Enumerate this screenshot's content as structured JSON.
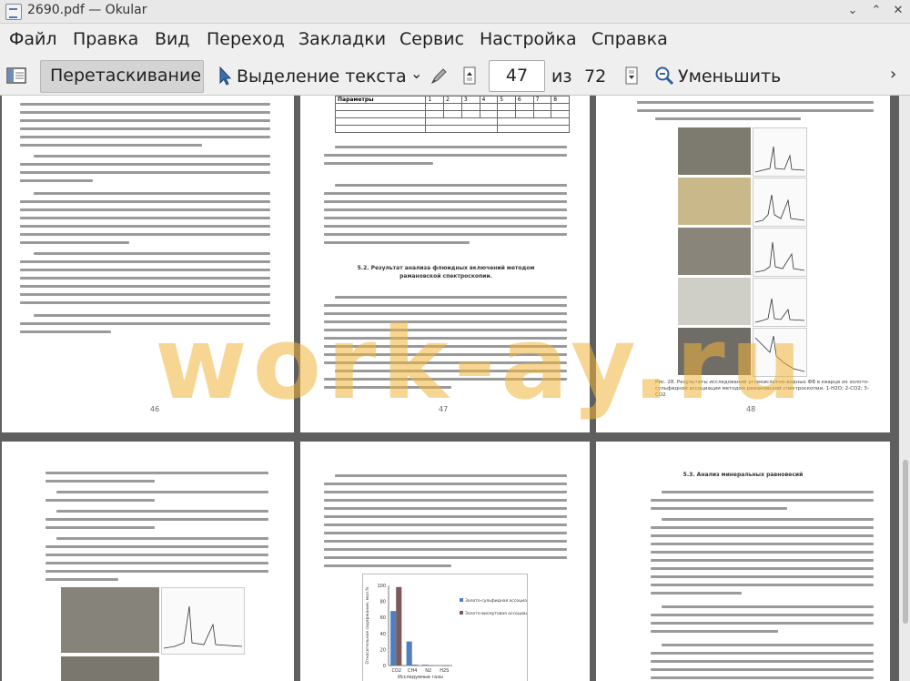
{
  "window": {
    "title": "2690.pdf  — Okular",
    "controls": [
      "minimize-icon",
      "maximize-icon",
      "close-icon"
    ]
  },
  "menu": [
    "Файл",
    "Правка",
    "Вид",
    "Переход",
    "Закладки",
    "Сервис",
    "Настройка",
    "Справка"
  ],
  "toolbar": {
    "browse_label": "Перетаскивание",
    "select_text_label": "Выделение текста",
    "page_current": "47",
    "page_of_label": "из",
    "page_total": "72",
    "zoom_out_label": "Уменьшить"
  },
  "pages": {
    "p46": "46",
    "p47": "47",
    "p48": "48",
    "p47_section": "5.2. Результат анализа флюидных включений методом рамановской спектроскопии.",
    "p50_section": "5.3. Анализ минеральных равновесий",
    "p48_caption": "Рис. 28. Результаты исследований углекислотно-водных ФВ в кварце из золото-сульфидной ассоциации методом рамановской спектроскопии. 1-H2O; 2-CO2; 3-CO2",
    "table_header": [
      "Параметры",
      "1",
      "2",
      "3",
      "4",
      "5",
      "6",
      "7",
      "8"
    ],
    "chart_legend": [
      "Золото-сульфидная ассоциация",
      "Золото-висмутовая ассоциация"
    ],
    "chart_xlabel": "Исследуемые газы",
    "chart_ylabel": "Относительное содержание, мол.%",
    "chart_x": [
      "CO2",
      "CH4",
      "N2",
      "H2S"
    ],
    "chart_y_ticks": [
      "100",
      "80",
      "60",
      "40",
      "20",
      "0"
    ]
  },
  "watermark": "work-ay.ru",
  "chart_data": {
    "type": "bar",
    "categories": [
      "CO2",
      "CH4",
      "N2",
      "H2S"
    ],
    "series": [
      {
        "name": "Золото-сульфидная ассоциация",
        "values": [
          68,
          30,
          1,
          0
        ],
        "color": "#4f7fc0"
      },
      {
        "name": "Золото-висмутовая ассоциация",
        "values": [
          98,
          1,
          0,
          0
        ],
        "color": "#7a5a5a"
      }
    ],
    "xlabel": "Исследуемые газы",
    "ylabel": "Относительное содержание, мол.%",
    "ylim": [
      0,
      100
    ]
  }
}
